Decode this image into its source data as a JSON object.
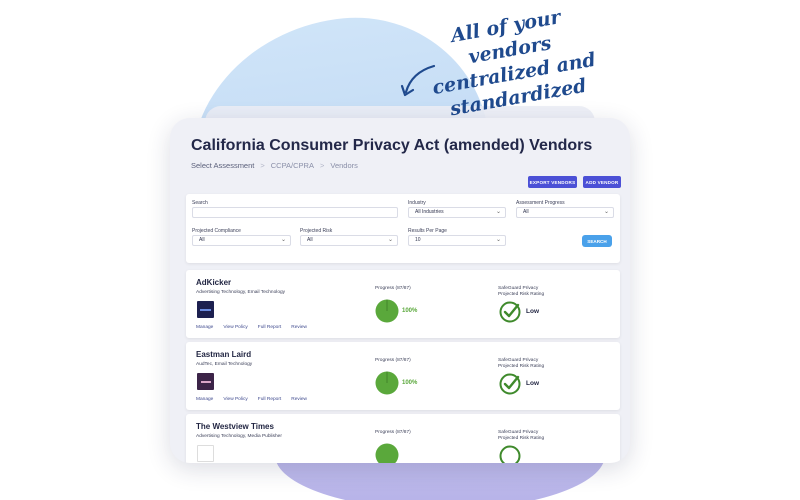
{
  "tagline": [
    "All of your vendors",
    "centralized and",
    "standardized"
  ],
  "page": {
    "title": "California Consumer Privacy Act (amended) Vendors",
    "breadcrumb": [
      "Select Assessment",
      "CCPA/CPRA",
      "Vendors"
    ]
  },
  "actions": {
    "export": "EXPORT VENDORS",
    "add": "ADD VENDOR"
  },
  "filters": {
    "search_label": "Search",
    "search_value": "",
    "industry_label": "Industry",
    "industry_value": "All Industries",
    "assessment_progress_label": "Assessment Progress",
    "assessment_progress_value": "All",
    "projected_compliance_label": "Projected Compliance",
    "projected_compliance_value": "All",
    "projected_risk_label": "Projected Risk",
    "projected_risk_value": "All",
    "results_per_page_label": "Results Per Page",
    "results_per_page_value": "10",
    "search_button": "SEARCH"
  },
  "vendor_links": [
    "Manage",
    "View Policy",
    "Full Report",
    "Review"
  ],
  "vendors": [
    {
      "name": "AdKicker",
      "category": "Advertising Technology, Email Technology",
      "progress_label": "Progress (87/87)",
      "progress_fraction": 1.0,
      "progress_value": "100%",
      "risk_label": [
        "SafeGuard Privacy",
        "Projected Risk Rating"
      ],
      "risk_value": "Low",
      "logo_color": "#1d2050"
    },
    {
      "name": "Eastman Laird",
      "category": "AudTec, Email Technology",
      "progress_label": "Progress (87/87)",
      "progress_fraction": 1.0,
      "progress_value": "100%",
      "risk_label": [
        "SafeGuard Privacy",
        "Projected Risk Rating"
      ],
      "risk_value": "Low",
      "logo_color": "#3c2448"
    },
    {
      "name": "The Westview Times",
      "category": "Advertising Technology, Media Publisher",
      "progress_label": "Progress (87/87)",
      "progress_fraction": 1.0,
      "progress_value": "",
      "risk_label": [
        "SafeGuard Privacy",
        "Projected Risk Rating"
      ],
      "risk_value": "",
      "logo_color": "#ffffff"
    }
  ],
  "colors": {
    "accent": "#4b50d6",
    "search_button": "#4aa1ea",
    "progress_green": "#5aa83b",
    "check_green": "#3f8a2c"
  },
  "icons": {
    "arrow": "curved-arrow-icon",
    "dropdown": "chevron-down-icon",
    "progress": "progress-pie-icon",
    "risk": "check-circle-icon"
  }
}
